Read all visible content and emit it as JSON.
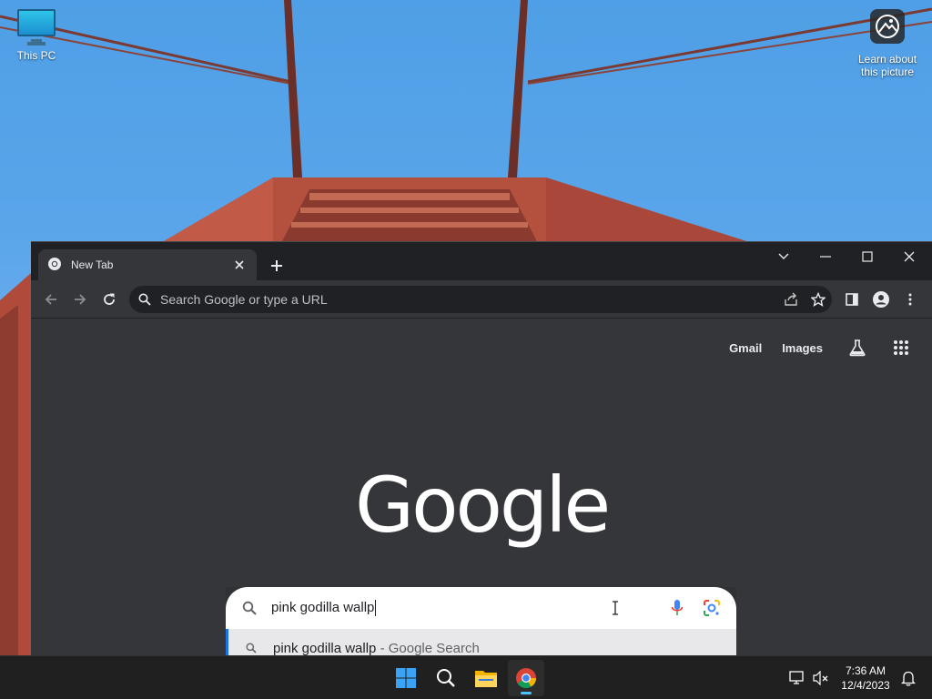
{
  "desktop": {
    "icons": [
      {
        "label": "This PC"
      },
      {
        "label_line1": "Learn about",
        "label_line2": "this picture"
      }
    ]
  },
  "browser": {
    "tab_title": "New Tab",
    "omnibox_placeholder": "Search Google or type a URL",
    "top_links": {
      "gmail": "Gmail",
      "images": "Images"
    },
    "logo_text": "Google",
    "search": {
      "query": "pink godilla wallp",
      "suggestion_query": "pink godilla wallp",
      "suggestion_suffix": " - Google Search"
    }
  },
  "taskbar": {
    "time": "7:36 AM",
    "date": "12/4/2023"
  },
  "colors": {
    "accent_blue": "#1a73e8",
    "chrome_dark": "#202124",
    "chrome_surface": "#35363a",
    "taskbar_bg": "#202020"
  }
}
